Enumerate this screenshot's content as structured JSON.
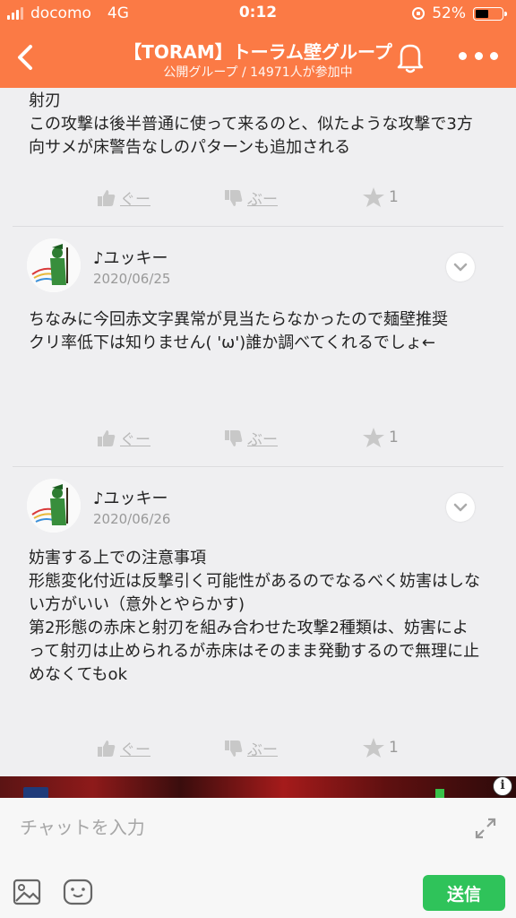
{
  "status_bar": {
    "carrier": "docomo",
    "network": "4G",
    "time": "0:12",
    "battery": "52%",
    "battery_level": 0.52
  },
  "header": {
    "title": "【TORAM】トーラム壁グループ",
    "subtitle": "公開グループ / 14971人が参加中"
  },
  "posts": [
    {
      "text": "射刃\nこの攻撃は後半普通に使って来るのと、似たような攻撃で3方向サメが床警告なしのパターンも追加される",
      "like": "ぐー",
      "dislike": "ぶー",
      "stars": "1"
    },
    {
      "user": "♪ユッキー",
      "date": "2020/06/25",
      "text": "ちなみに今回赤文字異常が見当たらなかったので麺壁推奨\nクリ率低下は知りません( 'ω')誰か調べてくれるでしょ←",
      "like": "ぐー",
      "dislike": "ぶー",
      "stars": "1"
    },
    {
      "user": "♪ユッキー",
      "date": "2020/06/26",
      "text": "妨害する上での注意事項\n形態変化付近は反撃引く可能性があるのでなるべく妨害はしない方がいい（意外とやらかす)\n第2形態の赤床と射刃を組み合わせた攻撃2種類は、妨害によって射刃は止められるが赤床はそのまま発動するので無理に止めなくてもok",
      "like": "ぐー",
      "dislike": "ぶー",
      "stars": "1"
    }
  ],
  "input": {
    "placeholder": "チャットを入力",
    "send_label": "送信"
  },
  "ad": {
    "info_label": "i"
  },
  "colors": {
    "header": "#fb7a45",
    "send": "#2fc35a",
    "background": "#efeff1"
  }
}
